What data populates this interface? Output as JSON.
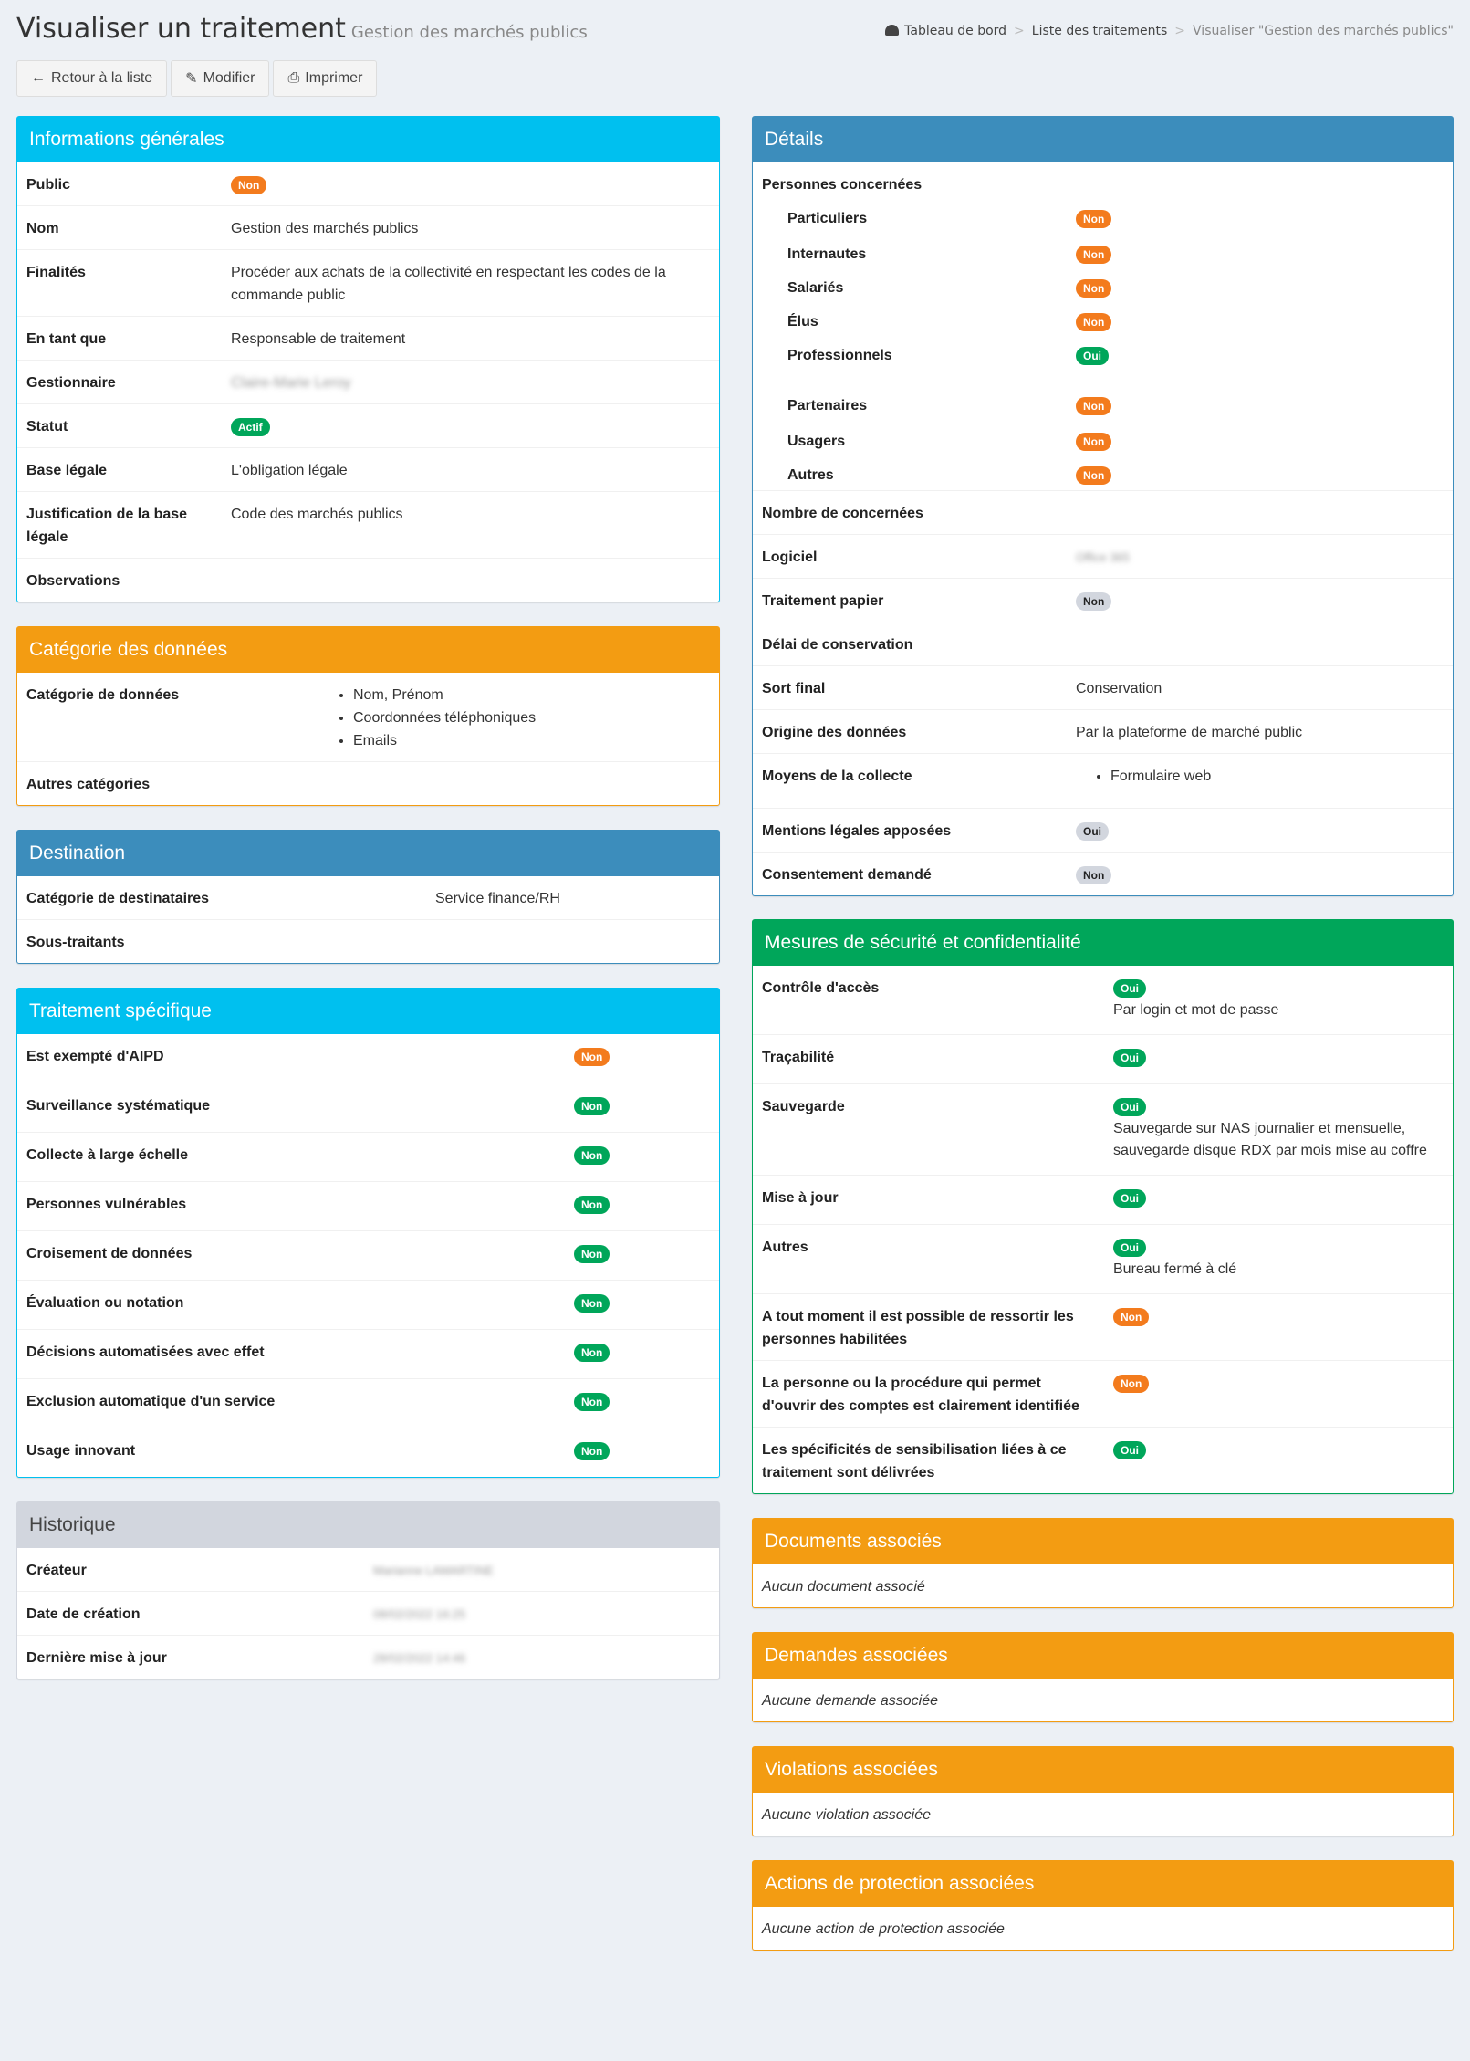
{
  "header": {
    "title": "Visualiser un traitement",
    "subtitle": "Gestion des marchés publics",
    "breadcrumb": [
      "Tableau de bord",
      "Liste des traitements",
      "Visualiser \"Gestion des marchés publics\""
    ]
  },
  "toolbar": {
    "back_label": "Retour à la liste",
    "edit_label": "Modifier",
    "print_label": "Imprimer"
  },
  "general": {
    "title": "Informations générales",
    "public_label": "Public",
    "public_value": "Non",
    "nom_label": "Nom",
    "nom_value": "Gestion des marchés publics",
    "finalites_label": "Finalités",
    "finalites_value": "Procéder aux achats de la collectivité en respectant les codes de la commande public",
    "entantque_label": "En tant que",
    "entantque_value": "Responsable de traitement",
    "gestionnaire_label": "Gestionnaire",
    "gestionnaire_value": "Claire-Marie Leroy",
    "statut_label": "Statut",
    "statut_value": "Actif",
    "base_label": "Base légale",
    "base_value": "L'obligation légale",
    "justif_label": "Justification de la base légale",
    "justif_value": "Code des marchés publics",
    "obs_label": "Observations"
  },
  "categorie": {
    "title": "Catégorie des données",
    "cat_label": "Catégorie de données",
    "items": [
      "Nom, Prénom",
      "Coordonnées téléphoniques",
      "Emails"
    ],
    "autres_label": "Autres catégories"
  },
  "destination": {
    "title": "Destination",
    "dest_label": "Catégorie de destinataires",
    "dest_value": "Service finance/RH",
    "sous_label": "Sous-traitants"
  },
  "specifique": {
    "title": "Traitement spécifique",
    "rows": [
      {
        "label": "Est exempté d'AIPD",
        "value": "Non"
      },
      {
        "label": "Surveillance systématique",
        "value": "Non"
      },
      {
        "label": "Collecte à large échelle",
        "value": "Non"
      },
      {
        "label": "Personnes vulnérables",
        "value": "Non"
      },
      {
        "label": "Croisement de données",
        "value": "Non"
      },
      {
        "label": "Évaluation ou notation",
        "value": "Non"
      },
      {
        "label": "Décisions automatisées avec effet",
        "value": "Non"
      },
      {
        "label": "Exclusion automatique d'un service",
        "value": "Non"
      },
      {
        "label": "Usage innovant",
        "value": "Non"
      }
    ]
  },
  "historique": {
    "title": "Historique",
    "createur_label": "Créateur",
    "createur_value": "Marianne LAMARTINE",
    "date_label": "Date de création",
    "date_value": "08/02/2022 16:25",
    "maj_label": "Dernière mise à jour",
    "maj_value": "28/02/2022 14:46"
  },
  "details": {
    "title": "Détails",
    "personnes_label": "Personnes concernées",
    "personnes": [
      {
        "label": "Particuliers",
        "value": "Non"
      },
      {
        "label": "Internautes",
        "value": "Non"
      },
      {
        "label": "Salariés",
        "value": "Non"
      },
      {
        "label": "Élus",
        "value": "Non"
      },
      {
        "label": "Professionnels",
        "value": "Oui"
      },
      {
        "label": "Partenaires",
        "value": "Non"
      },
      {
        "label": "Usagers",
        "value": "Non"
      },
      {
        "label": "Autres",
        "value": "Non"
      }
    ],
    "nombre_label": "Nombre de concernées",
    "logiciel_label": "Logiciel",
    "logiciel_value": "Office 365",
    "papier_label": "Traitement papier",
    "papier_value": "Non",
    "delai_label": "Délai de conservation",
    "sort_label": "Sort final",
    "sort_value": "Conservation",
    "origine_label": "Origine des données",
    "origine_value": "Par la plateforme de marché public",
    "moyens_label": "Moyens de la collecte",
    "moyens_items": [
      "Formulaire web"
    ],
    "mentions_label": "Mentions légales apposées",
    "mentions_value": "Oui",
    "consent_label": "Consentement demandé",
    "consent_value": "Non"
  },
  "securite": {
    "title": "Mesures de sécurité et confidentialité",
    "controle_label": "Contrôle d'accès",
    "controle_value": "Oui",
    "controle_text": "Par login et mot de passe",
    "traca_label": "Traçabilité",
    "traca_value": "Oui",
    "sauve_label": "Sauvegarde",
    "sauve_value": "Oui",
    "sauve_text": "Sauvegarde sur NAS journalier et mensuelle, sauvegarde disque RDX par mois mise au coffre",
    "maj_label": "Mise à jour",
    "maj_value": "Oui",
    "autres_label": "Autres",
    "autres_value": "Oui",
    "autres_text": "Bureau fermé à clé",
    "ressortir_label": "A tout moment il est possible de ressortir les personnes habilitées",
    "ressortir_value": "Non",
    "procedure_label": "La personne ou la procédure qui permet d'ouvrir des comptes est clairement identifiée",
    "procedure_value": "Non",
    "sensib_label": "Les spécificités de sensibilisation liées à ce traitement sont délivrées",
    "sensib_value": "Oui"
  },
  "documents": {
    "title": "Documents associés",
    "empty": "Aucun document associé"
  },
  "demandes": {
    "title": "Demandes associées",
    "empty": "Aucune demande associée"
  },
  "violations": {
    "title": "Violations associées",
    "empty": "Aucune violation associée"
  },
  "actions": {
    "title": "Actions de protection associées",
    "empty": "Aucune action de protection associée"
  }
}
